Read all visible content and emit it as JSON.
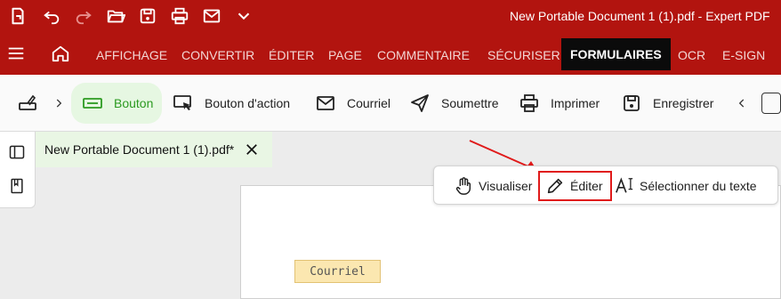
{
  "window": {
    "title": "New Portable Document 1 (1).pdf   -   Expert PDF"
  },
  "menu": {
    "items": [
      "AFFICHAGE",
      "CONVERTIR",
      "ÉDITER",
      "PAGE",
      "COMMENTAIRE",
      "SÉCURISER",
      "FORMULAIRES",
      "OCR",
      "E-SIGN"
    ],
    "active": "FORMULAIRES"
  },
  "ribbon": {
    "items": [
      {
        "label": "Bouton",
        "icon": "button-field-icon"
      },
      {
        "label": "Bouton d'action",
        "icon": "action-button-icon"
      },
      {
        "label": "Courriel",
        "icon": "mail-icon"
      },
      {
        "label": "Soumettre",
        "icon": "send-icon"
      },
      {
        "label": "Imprimer",
        "icon": "printer-icon"
      },
      {
        "label": "Enregistrer",
        "icon": "save-icon"
      }
    ]
  },
  "document": {
    "tab_label": "New Portable Document 1 (1).pdf*",
    "field_label": "Courriel"
  },
  "mode_bar": {
    "items": [
      {
        "label": "Visualiser",
        "icon": "hand-icon"
      },
      {
        "label": "Éditer",
        "icon": "pencil-icon"
      },
      {
        "label": "Sélectionner du texte",
        "icon": "select-text-icon"
      }
    ]
  },
  "colors": {
    "brand_red": "#b2140f",
    "active_green": "#2c9a21",
    "annotation_red": "#e01a1a",
    "field_fill": "#fbe7b0"
  }
}
